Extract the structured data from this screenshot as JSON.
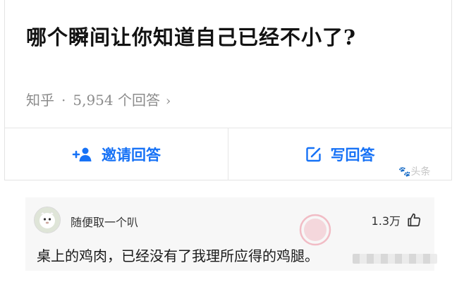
{
  "question": {
    "title": "哪个瞬间让你知道自己已经不小了?",
    "source": "知乎",
    "separator": "·",
    "answer_count": "5,954 个回答",
    "chevron": "›"
  },
  "actions": {
    "invite_label": "邀请回答",
    "write_label": "写回答"
  },
  "watermark": "头条",
  "comment": {
    "username": "随便取一个叭",
    "likes": "1.3万",
    "text": "桌上的鸡肉，已经没有了我理所应得的鸡腿。"
  },
  "colors": {
    "accent": "#1772f6",
    "stamp": "#e8506a"
  },
  "icons": {
    "invite": "add-user-icon",
    "write": "edit-icon",
    "like": "thumbs-up-icon",
    "stamp": "stamp-icon"
  }
}
